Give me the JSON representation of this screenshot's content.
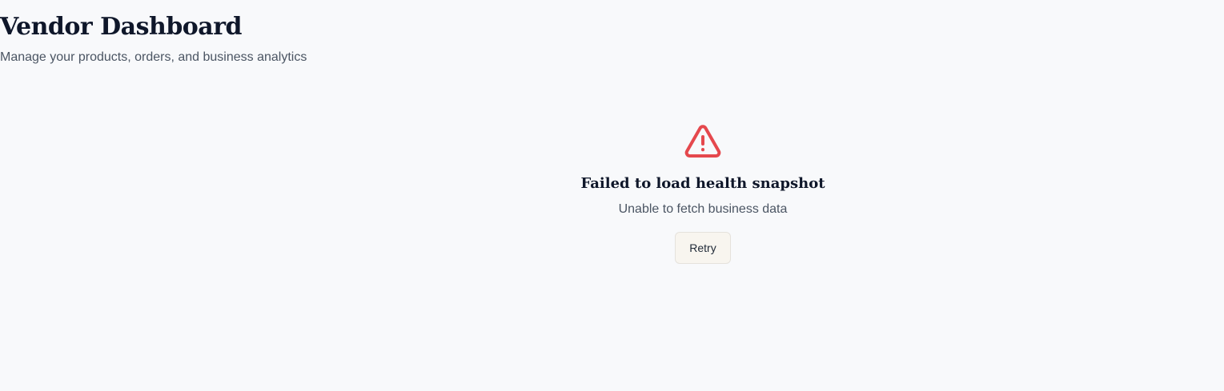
{
  "header": {
    "title": "Vendor Dashboard",
    "subtitle": "Manage your products, orders, and business analytics"
  },
  "error": {
    "icon": "warning-triangle-icon",
    "icon_color": "#e5484d",
    "title": "Failed to load health snapshot",
    "message": "Unable to fetch business data",
    "retry_label": "Retry"
  }
}
